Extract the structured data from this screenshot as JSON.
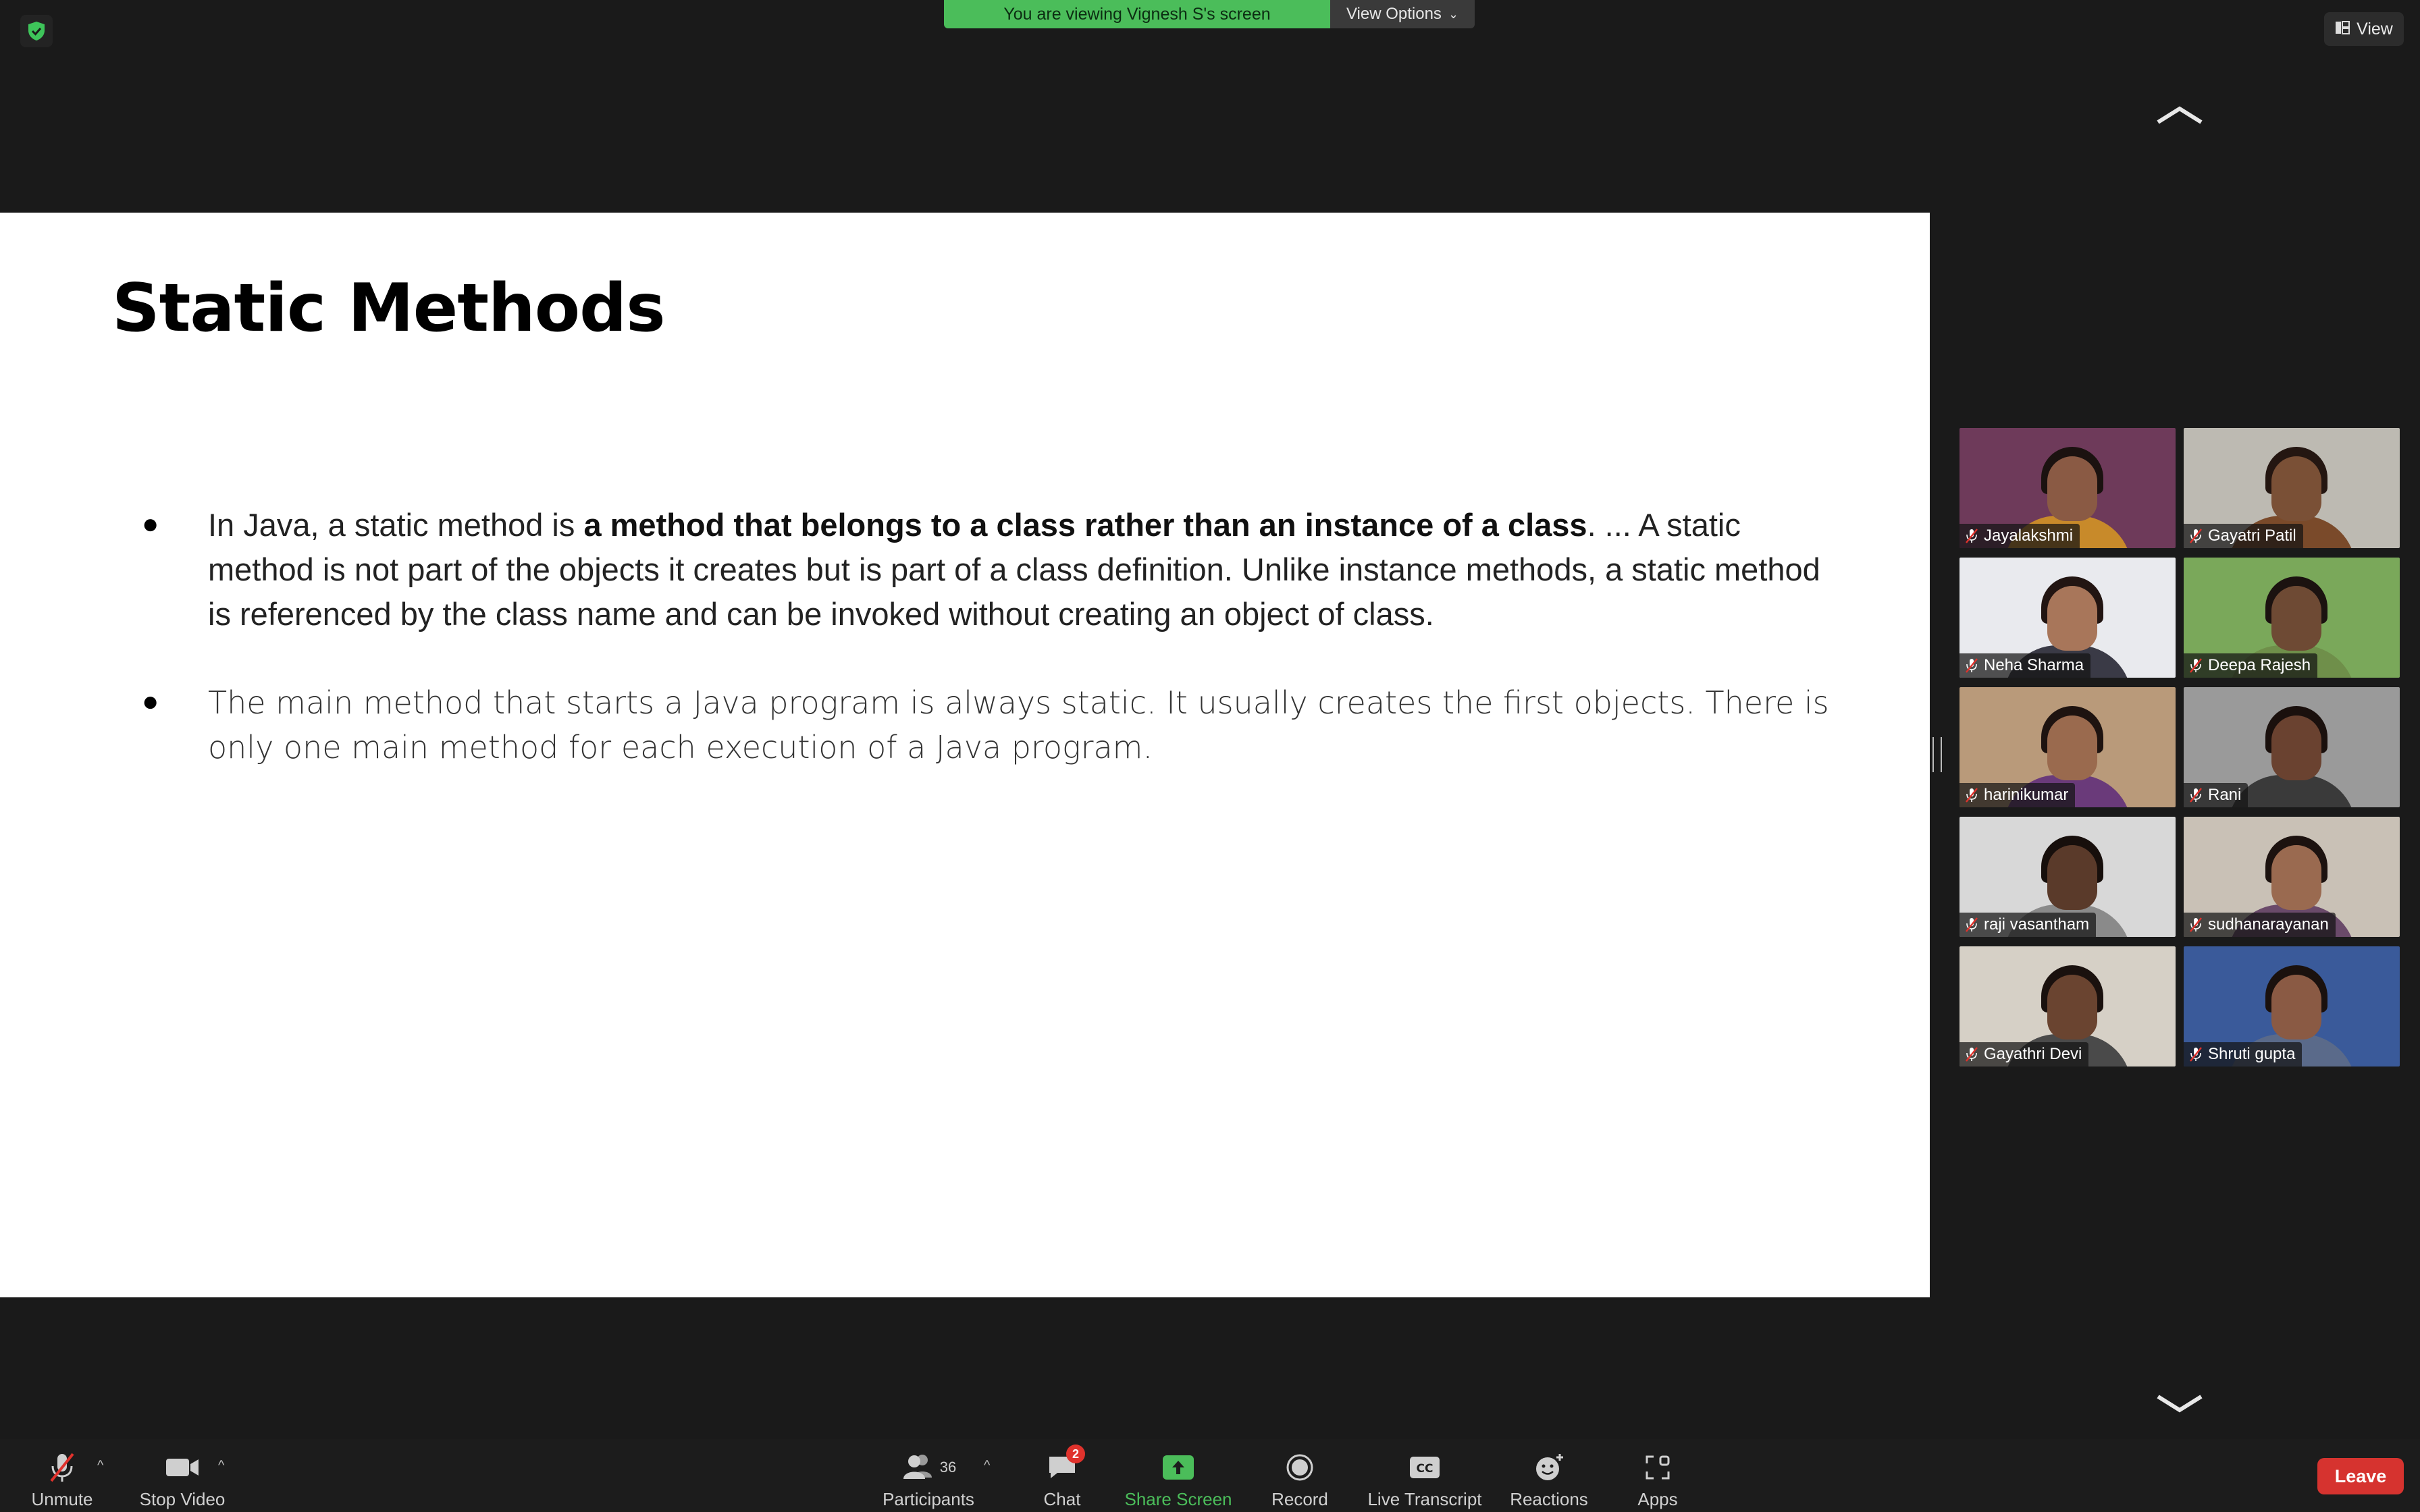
{
  "top_bar": {
    "viewing_banner": "You are viewing Vignesh S's screen",
    "view_options": "View Options",
    "view_button": "View"
  },
  "slide": {
    "title": "Static Methods",
    "bullet1": {
      "before": "In Java, a static method is ",
      "bold": "a method that belongs to a class rather than an instance of a class",
      "after": ". ... A static method is not part of the objects it creates but is part of a class definition. Unlike instance methods, a static method is referenced by the class name and can be invoked without creating an object of class."
    },
    "bullet2": "The main method that starts a Java program is always static. It usually creates the first objects. There is only one main method for each execution of a Java program."
  },
  "gallery": {
    "participants": [
      {
        "name": "Jayalakshmi",
        "muted": true
      },
      {
        "name": "Gayatri Patil",
        "muted": true
      },
      {
        "name": "Neha Sharma",
        "muted": true
      },
      {
        "name": "Deepa Rajesh",
        "muted": true
      },
      {
        "name": "harinikumar",
        "muted": true
      },
      {
        "name": "Rani",
        "muted": true
      },
      {
        "name": "raji vasantham",
        "muted": true
      },
      {
        "name": "sudhanarayanan",
        "muted": true
      },
      {
        "name": "Gayathri Devi",
        "muted": true
      },
      {
        "name": "Shruti gupta",
        "muted": true
      }
    ]
  },
  "toolbar": {
    "unmute": "Unmute",
    "stop_video": "Stop Video",
    "participants": "Participants",
    "participants_count": "36",
    "chat": "Chat",
    "chat_badge": "2",
    "share_screen": "Share Screen",
    "record": "Record",
    "live_transcript": "Live Transcript",
    "reactions": "Reactions",
    "apps": "Apps",
    "leave": "Leave"
  },
  "colors": {
    "share_green": "#4bbd5a",
    "leave_red": "#d6332f",
    "muted_red": "#e0322c"
  }
}
